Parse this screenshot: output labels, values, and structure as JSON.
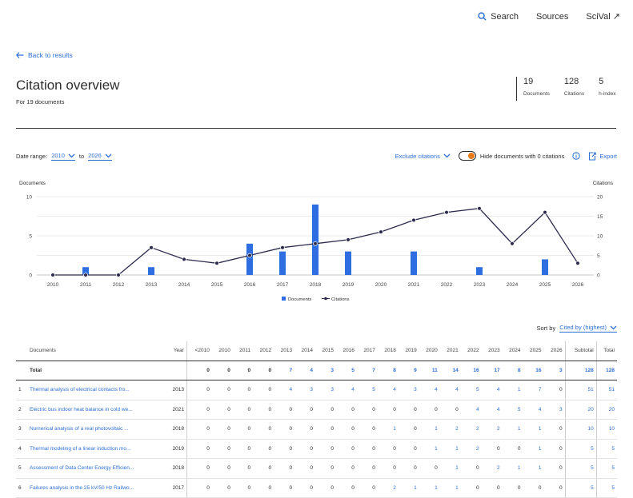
{
  "nav": {
    "search": "Search",
    "sources": "Sources",
    "scival": "SciVal ↗"
  },
  "back": "Back to results",
  "title": "Citation overview",
  "subtitle": "For 19 documents",
  "metrics": [
    {
      "value": "19",
      "label": "Documents"
    },
    {
      "value": "128",
      "label": "Citations"
    },
    {
      "value": "5",
      "label": "h-index"
    }
  ],
  "date_range": {
    "label": "Date range:",
    "from": "2010",
    "to_label": "to",
    "to": "2026"
  },
  "controls": {
    "exclude": "Exclude citations",
    "hide": "Hide documents with 0 citations",
    "export": "Export"
  },
  "chart_data": {
    "type": "bar+line",
    "categories": [
      "2010",
      "2011",
      "2012",
      "2013",
      "2014",
      "2015",
      "2016",
      "2017",
      "2018",
      "2019",
      "2020",
      "2021",
      "2022",
      "2023",
      "2024",
      "2025",
      "2026"
    ],
    "series": [
      {
        "name": "Documents",
        "type": "bar",
        "axis": "left",
        "values": [
          0,
          1,
          0,
          1,
          0,
          0,
          4,
          3,
          9,
          3,
          0,
          3,
          0,
          1,
          0,
          2,
          0
        ]
      },
      {
        "name": "Citations",
        "type": "line",
        "axis": "right",
        "values": [
          0,
          0,
          0,
          7,
          4,
          3,
          5,
          7,
          8,
          9,
          11,
          14,
          16,
          17,
          8,
          16,
          3
        ]
      }
    ],
    "ylabel_left": "Documents",
    "ylim_left": [
      0,
      10
    ],
    "yticks_left": [
      0,
      5,
      10
    ],
    "ylabel_right": "Citations",
    "ylim_right": [
      0,
      20
    ],
    "yticks_right": [
      0,
      5,
      10,
      15,
      20
    ],
    "legend": "bottom",
    "colors": {
      "bar": "#2f6ee0",
      "line": "#2b2a4c"
    }
  },
  "sort": {
    "label": "Sort by",
    "value": "Cited by (highest)"
  },
  "table": {
    "headers": [
      "Documents",
      "Year",
      "<2010",
      "2010",
      "2011",
      "2012",
      "2013",
      "2014",
      "2015",
      "2016",
      "2017",
      "2018",
      "2019",
      "2020",
      "2021",
      "2022",
      "2023",
      "2024",
      "2025",
      "2026",
      "Subtotal",
      "Total"
    ],
    "total": {
      "label": "Total",
      "values": [
        "0",
        "0",
        "0",
        "0",
        "7",
        "4",
        "3",
        "5",
        "7",
        "8",
        "9",
        "11",
        "14",
        "16",
        "17",
        "8",
        "16",
        "3",
        "128",
        "128"
      ]
    },
    "rows": [
      {
        "n": "1",
        "title": "Thermal analysis of electrical contacts fro...",
        "year": "2013",
        "values": [
          "0",
          "0",
          "0",
          "0",
          "4",
          "3",
          "3",
          "4",
          "5",
          "4",
          "3",
          "4",
          "4",
          "5",
          "4",
          "1",
          "7",
          "0",
          "51",
          "51"
        ]
      },
      {
        "n": "2",
        "title": "Electric bus indoor heat balance in cold we...",
        "year": "2021",
        "values": [
          "0",
          "0",
          "0",
          "0",
          "0",
          "0",
          "0",
          "0",
          "0",
          "0",
          "0",
          "0",
          "0",
          "4",
          "4",
          "5",
          "4",
          "3",
          "20",
          "20"
        ]
      },
      {
        "n": "3",
        "title": "Numerical analysis of a real photovoltaic ...",
        "year": "2018",
        "values": [
          "0",
          "0",
          "0",
          "0",
          "0",
          "0",
          "0",
          "0",
          "0",
          "1",
          "0",
          "1",
          "2",
          "2",
          "2",
          "1",
          "1",
          "0",
          "10",
          "10"
        ]
      },
      {
        "n": "4",
        "title": "Thermal modeling of a linear induction mo...",
        "year": "2019",
        "values": [
          "0",
          "0",
          "0",
          "0",
          "0",
          "0",
          "0",
          "0",
          "0",
          "0",
          "0",
          "1",
          "1",
          "2",
          "0",
          "0",
          "1",
          "0",
          "5",
          "5"
        ]
      },
      {
        "n": "5",
        "title": "Assessment of Data Center Energy Efficien...",
        "year": "2018",
        "values": [
          "0",
          "0",
          "0",
          "0",
          "0",
          "0",
          "0",
          "0",
          "0",
          "0",
          "0",
          "0",
          "1",
          "0",
          "2",
          "1",
          "1",
          "0",
          "5",
          "5"
        ]
      },
      {
        "n": "6",
        "title": "Failures analysis in the 25 kV/50 Hz Railwo...",
        "year": "2017",
        "values": [
          "0",
          "0",
          "0",
          "0",
          "0",
          "0",
          "0",
          "0",
          "0",
          "2",
          "1",
          "1",
          "1",
          "0",
          "0",
          "0",
          "0",
          "0",
          "5",
          "5"
        ]
      }
    ]
  }
}
